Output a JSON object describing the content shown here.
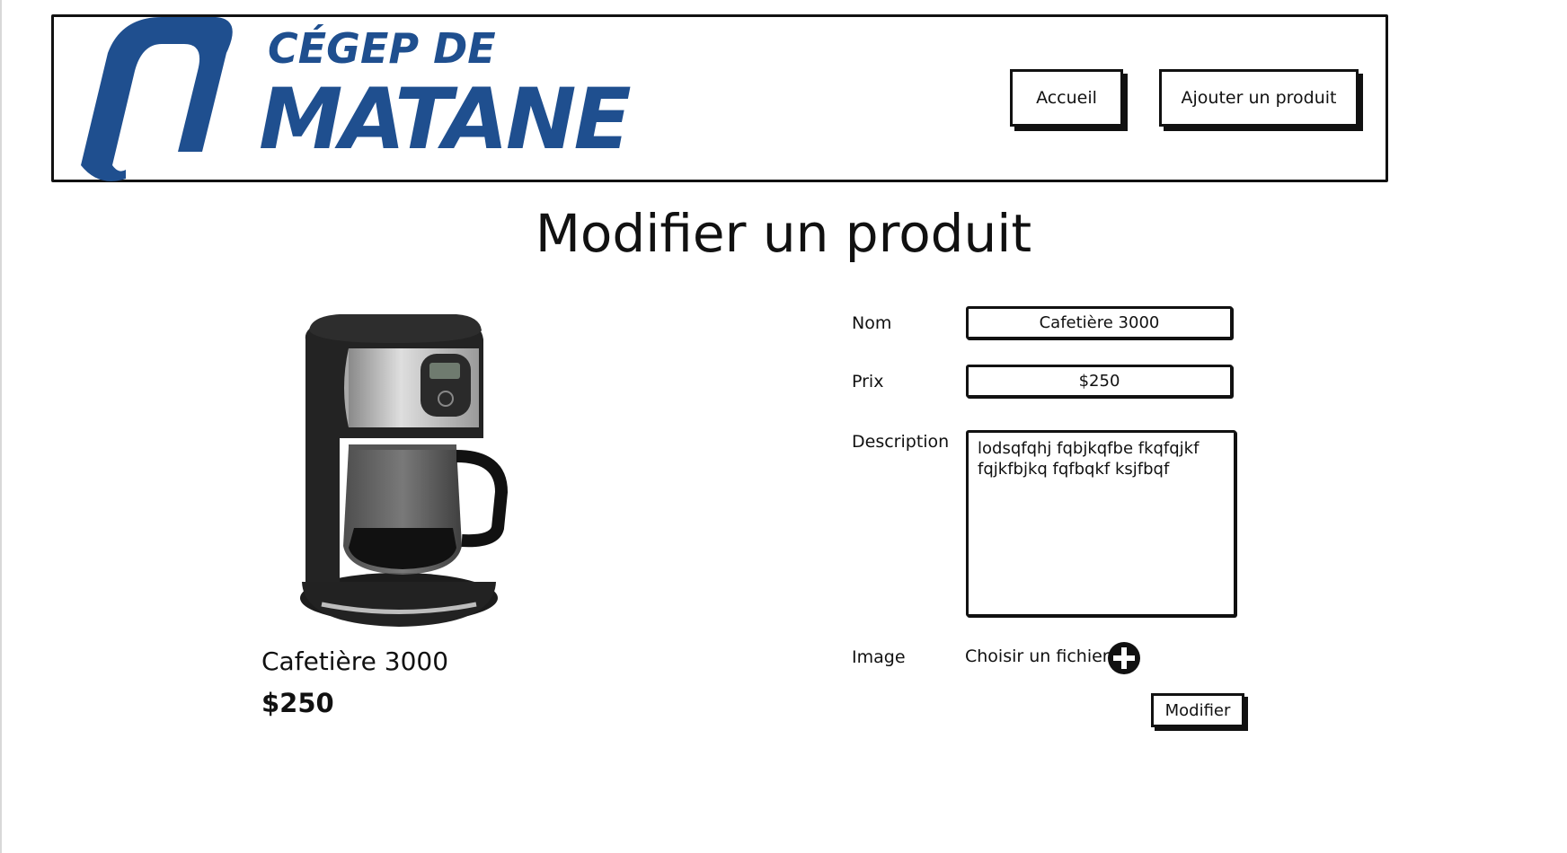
{
  "header": {
    "logo": {
      "line1": "CÉGEP DE",
      "line2": "MATANE",
      "color": "#1f4f8f"
    },
    "nav": {
      "home_label": "Accueil",
      "add_product_label": "Ajouter un produit"
    }
  },
  "page": {
    "title": "Modifier un produit"
  },
  "preview": {
    "image_icon": "coffee-maker-image",
    "name": "Cafetière 3000",
    "price": "$250"
  },
  "form": {
    "name_label": "Nom",
    "name_value": "Cafetière 3000",
    "price_label": "Prix",
    "price_value": "$250",
    "description_label": "Description",
    "description_value": "lodsqfqhj fqbjkqfbe fkqfqjkf fqjkfbjkq fqfbqkf ksjfbqf",
    "image_label": "Image",
    "file_chooser_label": "Choisir un fichier",
    "file_add_icon": "plus-circle-icon",
    "submit_label": "Modifier"
  }
}
